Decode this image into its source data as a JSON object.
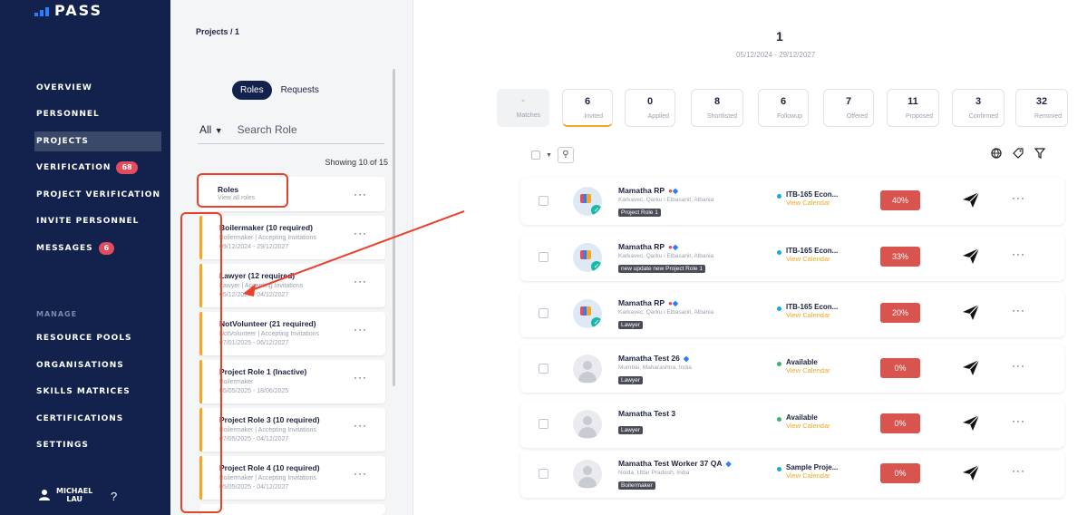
{
  "brand": {
    "name": "PASS",
    "accent": "#2b7fff",
    "sidebar_bg": "#12224d"
  },
  "sidebar": {
    "items": [
      {
        "label": "OVERVIEW"
      },
      {
        "label": "PERSONNEL"
      },
      {
        "label": "PROJECTS",
        "active": true
      },
      {
        "label": "VERIFICATION",
        "badge": "68"
      },
      {
        "label": "PROJECT VERIFICATION"
      },
      {
        "label": "INVITE PERSONNEL"
      },
      {
        "label": "MESSAGES",
        "badge": "6"
      }
    ],
    "section_label": "MANAGE",
    "manage_items": [
      {
        "label": "RESOURCE POOLS"
      },
      {
        "label": "ORGANISATIONS"
      },
      {
        "label": "SKILLS MATRICES"
      },
      {
        "label": "CERTIFICATIONS"
      },
      {
        "label": "SETTINGS"
      }
    ],
    "user": {
      "first": "MICHAEL",
      "last": "LAU",
      "help": "?"
    }
  },
  "roles_panel": {
    "breadcrumb": "Projects / 1",
    "toggle": {
      "on": "Roles",
      "off": "Requests"
    },
    "filter": {
      "value": "All",
      "search_placeholder": "Search Role"
    },
    "showing": "Showing 10 of 15",
    "header_card": {
      "title": "Roles",
      "subtitle": "View all roles"
    },
    "roles": [
      {
        "title": "Boilermaker (10 required)",
        "line1": "Boilermaker | Accepting Invitations",
        "line2": "09/12/2024 - 29/12/2027"
      },
      {
        "title": "Lawyer (12 required)",
        "line1": "Lawyer | Accepting Invitations",
        "line2": "05/12/2024 - 04/12/2027"
      },
      {
        "title": "NotVolunteer (21 required)",
        "line1": "NotVolunteer | Accepting Invitations",
        "line2": "07/01/2025 - 06/12/2027"
      },
      {
        "title": "Project Role 1 (Inactive)",
        "line1": "Boilermaker",
        "line2": "05/05/2025 - 18/06/2025"
      },
      {
        "title": "Project Role 3 (10 required)",
        "line1": "Boilermaker | Accepting Invitations",
        "line2": "07/05/2025 - 04/12/2027"
      },
      {
        "title": "Project Role 4 (10 required)",
        "line1": "Boilermaker | Accepting Invitations",
        "line2": "05/05/2025 - 04/12/2027"
      }
    ],
    "menu_glyph": "···"
  },
  "project": {
    "number": "1",
    "dates": "05/12/2024 - 29/12/2027"
  },
  "stats": [
    {
      "value": "-",
      "label": "Matches"
    },
    {
      "value": "6",
      "label": "Invited"
    },
    {
      "value": "0",
      "label": "Applied"
    },
    {
      "value": "8",
      "label": "Shortlisted"
    },
    {
      "value": "6",
      "label": "Followup"
    },
    {
      "value": "7",
      "label": "Offered"
    },
    {
      "value": "11",
      "label": "Proposed"
    },
    {
      "value": "3",
      "label": "Confirmed"
    },
    {
      "value": "32",
      "label": "Removed"
    }
  ],
  "toolbar": {
    "search_icon": "search-icon",
    "right_icons": [
      "globe-icon",
      "tag-icon",
      "filter-icon"
    ]
  },
  "candidates": [
    {
      "name": "Mamatha RP",
      "location": "Karkavec, Qarku i Elbasanit, Albania",
      "pill": "Project Role 1",
      "status": "ITB-165 Econ...",
      "status_link": "View Calendar",
      "score": "40%",
      "photo": true
    },
    {
      "name": "Mamatha RP",
      "location": "Karkavec, Qarku i Elbasanit, Albania",
      "pill": "new update new Project Role 1",
      "status": "ITB-165 Econ...",
      "status_link": "View Calendar",
      "score": "33%",
      "photo": true
    },
    {
      "name": "Mamatha RP",
      "location": "Karkavec, Qarku i Elbasanit, Albania",
      "pill": "Lawyer",
      "status": "ITB-165 Econ...",
      "status_link": "View Calendar",
      "score": "20%",
      "photo": true
    },
    {
      "name": "Mamatha Test 26",
      "location": "Mumbai, Maharashtra, India",
      "pill": "Lawyer",
      "status": "Available",
      "status_link": "View Calendar",
      "score": "0%",
      "photo": false
    },
    {
      "name": "Mamatha Test 3",
      "location": "",
      "pill": "Lawyer",
      "status": "Available",
      "status_link": "View Calendar",
      "score": "0%",
      "photo": false
    },
    {
      "name": "Mamatha Test Worker 37 QA",
      "location": "Noida, Uttar Pradesh, India",
      "pill": "Boilermaker",
      "status": "Sample Proje...",
      "status_link": "View Calendar",
      "score": "0%",
      "photo": false
    }
  ],
  "colors": {
    "score_red": "#d9534f",
    "link_orange": "#f5a623",
    "stripe": "#f5a623",
    "annotation_red": "#e8412c"
  }
}
